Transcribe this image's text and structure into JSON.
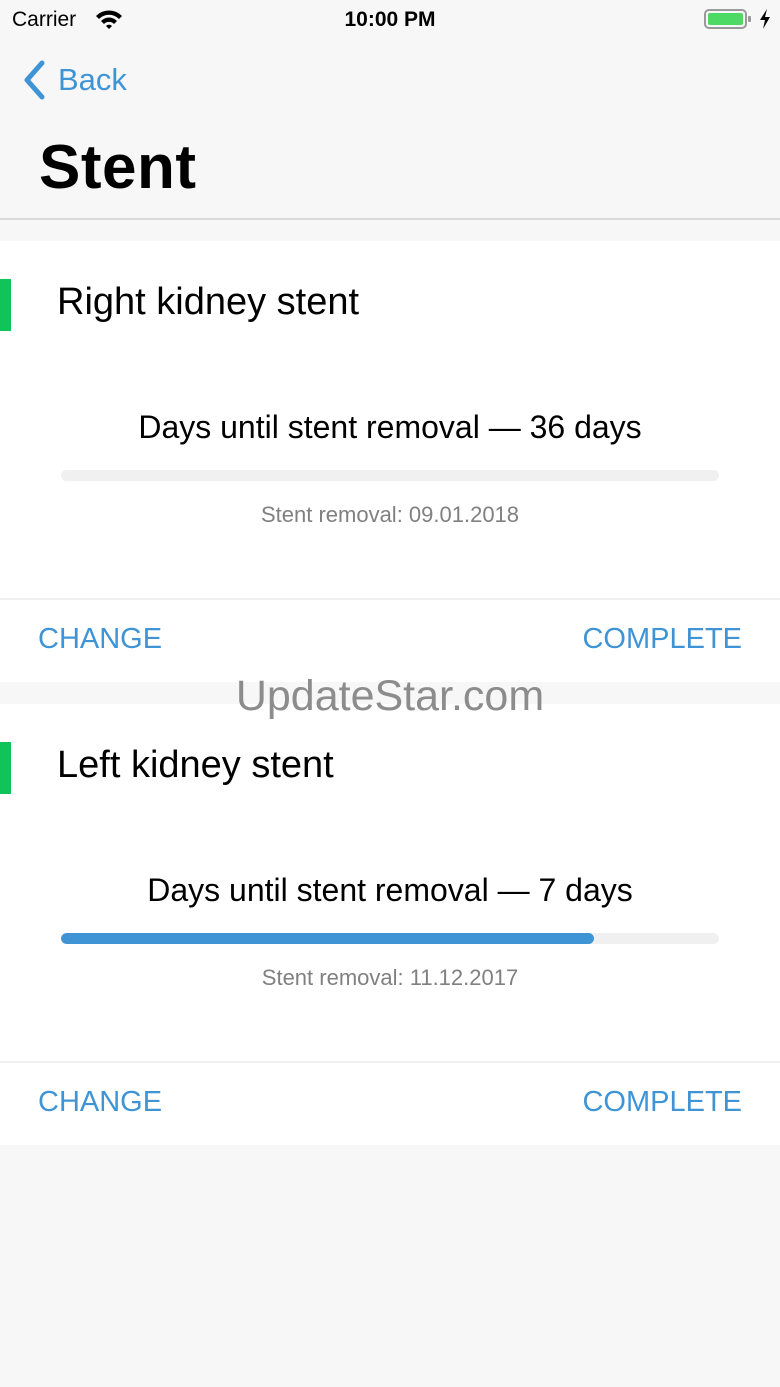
{
  "status_bar": {
    "carrier": "Carrier",
    "time": "10:00 PM",
    "battery_color": "#4cd964"
  },
  "navigation": {
    "back_label": "Back",
    "title": "Stent"
  },
  "accent_color": "#3f94d6",
  "status_color": "#11c45a",
  "stents": [
    {
      "name": "Right kidney stent",
      "days_text": "Days until stent removal — 36 days",
      "progress": 0,
      "removal_text": "Stent removal: 09.01.2018",
      "change_label": "CHANGE",
      "complete_label": "COMPLETE"
    },
    {
      "name": "Left kidney stent",
      "days_text": "Days until stent removal — 7 days",
      "progress": 0.81,
      "removal_text": "Stent removal: 11.12.2017",
      "change_label": "CHANGE",
      "complete_label": "COMPLETE"
    }
  ],
  "watermark": "UpdateStar.com"
}
